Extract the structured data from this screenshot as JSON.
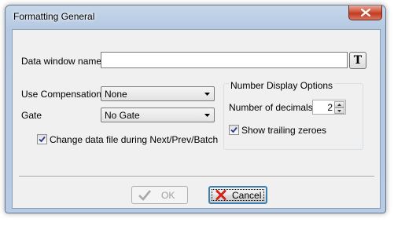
{
  "window": {
    "title": "Formatting General"
  },
  "form": {
    "data_window_name_label": "Data window name",
    "data_window_name_value": "",
    "font_button_label": "T",
    "use_compensation_label": "Use Compensation",
    "use_compensation_value": "None",
    "gate_label": "Gate",
    "gate_value": "No Gate",
    "change_data_file_label": "Change data file during Next/Prev/Batch",
    "change_data_file_checked": true
  },
  "number_display": {
    "group_label": "Number Display Options",
    "decimals_label": "Number of decimals",
    "decimals_value": "2",
    "trailing_zeroes_label": "Show trailing zeroes",
    "trailing_zeroes_checked": true
  },
  "buttons": {
    "ok_label": "OK",
    "ok_enabled": false,
    "cancel_label": "Cancel"
  },
  "colors": {
    "cancel_x": "#d4231b",
    "ok_check_disabled": "#a8a8a8"
  }
}
